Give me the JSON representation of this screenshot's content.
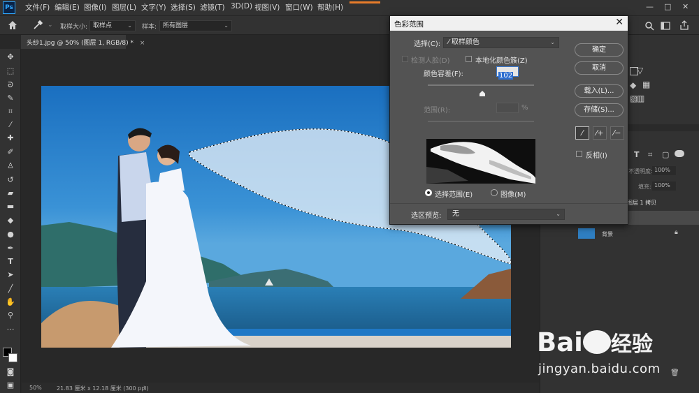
{
  "app": {
    "logo": "Ps"
  },
  "menu": [
    "文件(F)",
    "编辑(E)",
    "图像(I)",
    "图层(L)",
    "文字(Y)",
    "选择(S)",
    "滤镜(T)",
    "3D(D)",
    "视图(V)",
    "窗口(W)",
    "帮助(H)"
  ],
  "window_controls": {
    "minimize": "—",
    "maximize": "□",
    "close": "✕"
  },
  "options": {
    "sample_size_label": "取样大小:",
    "sample_size_value": "取样点",
    "sample_label": "样本:",
    "sample_value": "所有图层"
  },
  "document": {
    "tab_title": "头纱1.jpg @ 50% (图层 1, RGB/8) *",
    "tab_close": "×",
    "zoom": "50%",
    "doc_info": "21.83 厘米 x 12.18 厘米 (300 ppi)",
    "status_arrow": "›"
  },
  "dialog": {
    "title": "色彩范围",
    "close": "✕",
    "select_label": "选择(C):",
    "select_value": "取样颜色",
    "detect_faces": "检测人脸(D)",
    "localized_clusters": "本地化颜色簇(Z)",
    "fuzziness_label": "颜色容差(F):",
    "fuzziness_value": "102",
    "fuzziness_level": 0.51,
    "range_label": "范围(R):",
    "range_unit": "%",
    "buttons": {
      "ok": "确定",
      "cancel": "取消",
      "load": "载入(L)...",
      "save": "存储(S)..."
    },
    "invert_label": "反相(I)",
    "radio_selection": "选择范围(E)",
    "radio_image": "图像(M)",
    "preview_label": "选区预览:",
    "preview_value": "无"
  },
  "panel": {
    "opacity_label": "不透明度:",
    "opacity_value": "100%",
    "fill_label": "填充:",
    "fill_value": "100%",
    "layer_copy": "图层 1 拷贝",
    "layer_background": "背景"
  },
  "watermark": {
    "logo_text": "Bai",
    "logo_text2": "经验",
    "url": "jingyan.baidu.com"
  }
}
